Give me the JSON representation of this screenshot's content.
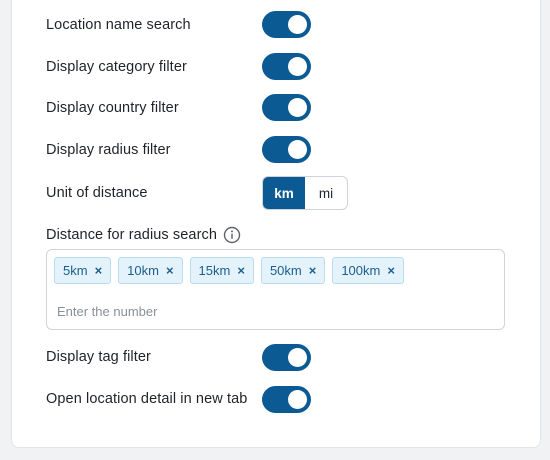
{
  "settings": {
    "location_name_search": {
      "label": "Location name search",
      "enabled": true
    },
    "category_filter": {
      "label": "Display category filter",
      "enabled": true
    },
    "country_filter": {
      "label": "Display country filter",
      "enabled": true
    },
    "radius_filter": {
      "label": "Display radius filter",
      "enabled": true
    },
    "unit_of_distance": {
      "label": "Unit of distance",
      "options": [
        "km",
        "mi"
      ],
      "selected": "km"
    },
    "radius_distances": {
      "label": "Distance for radius search",
      "tags": [
        "5km",
        "10km",
        "15km",
        "50km",
        "100km"
      ],
      "remove_glyph": "×",
      "placeholder": "Enter the number"
    },
    "tag_filter": {
      "label": "Display tag filter",
      "enabled": true
    },
    "open_new_tab": {
      "label": "Open location detail in new tab",
      "enabled": true
    }
  },
  "colors": {
    "accent": "#0c5a93",
    "tag_background": "#e4f2fb",
    "tag_text": "#1a5f8f"
  }
}
